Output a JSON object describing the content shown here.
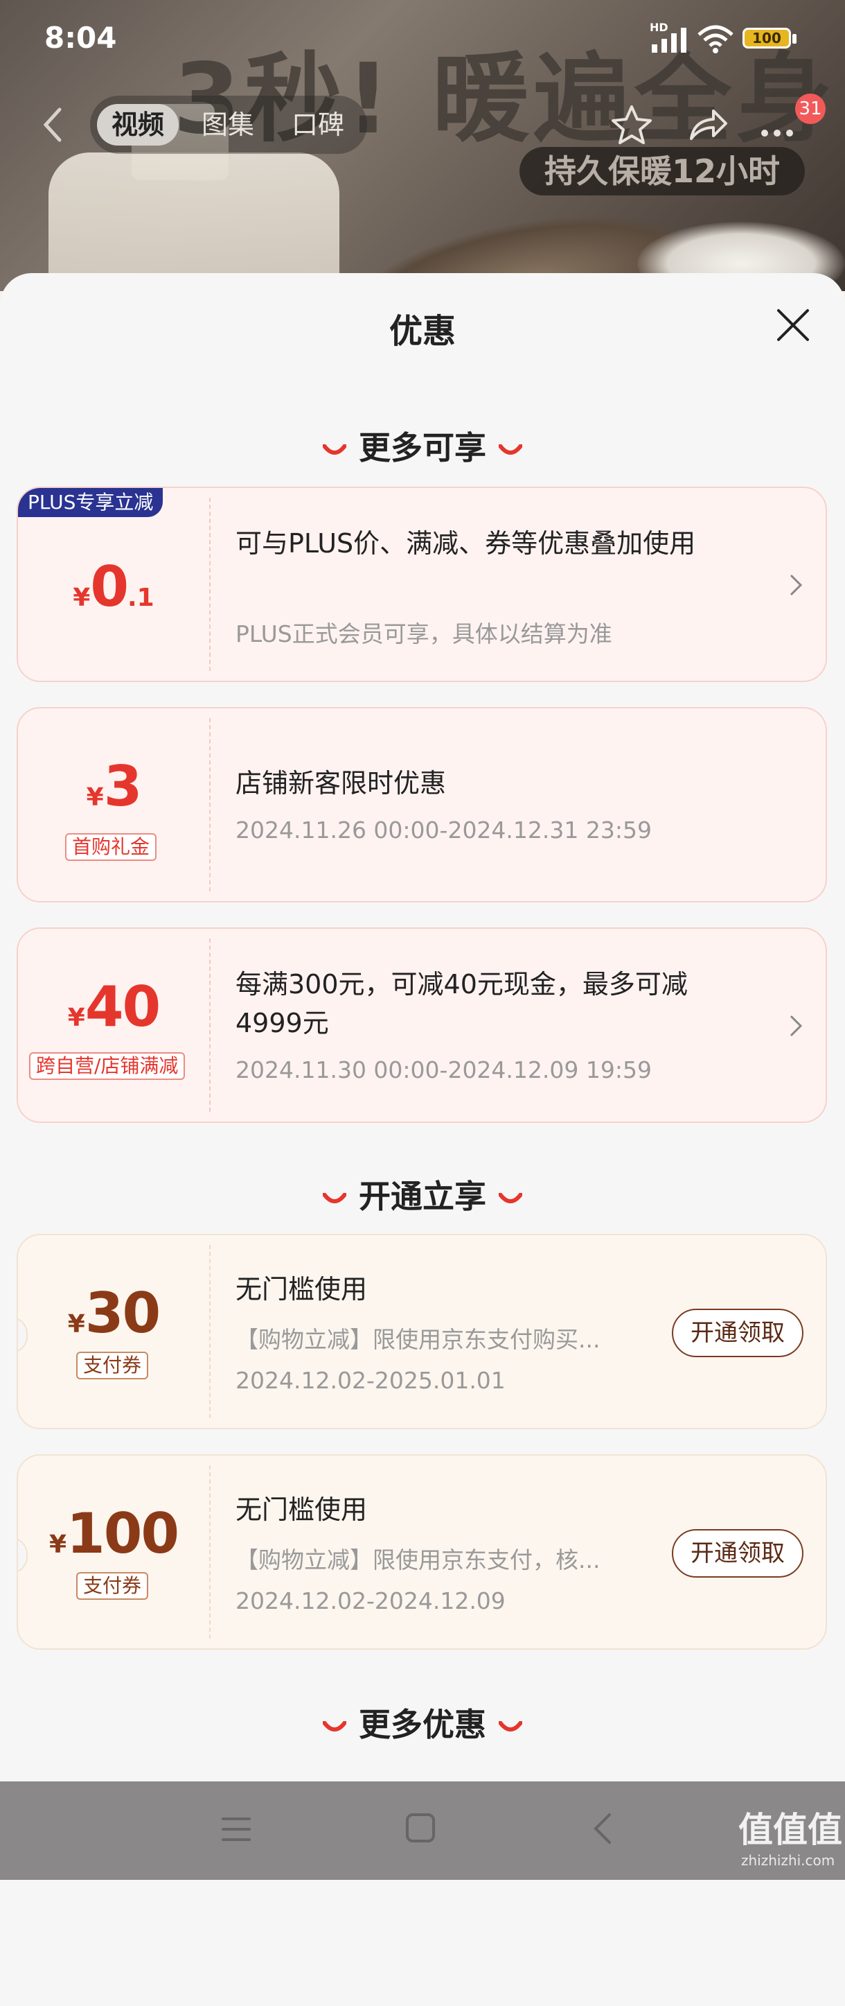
{
  "status_bar": {
    "time": "8:04",
    "network": "HD",
    "battery": "100"
  },
  "hero": {
    "headline": "3秒! 暖遍全身",
    "subline": "持久保暖12小时"
  },
  "top_nav": {
    "tabs": [
      {
        "label": "视频"
      },
      {
        "label": "图集"
      },
      {
        "label": "口碑"
      }
    ],
    "notification_count": "31"
  },
  "sheet": {
    "title": "优惠",
    "sections": [
      {
        "heading": "更多可享",
        "cards": [
          {
            "badge": "PLUS专享立减",
            "yen": "¥",
            "amount": "0",
            "decimal": ".1",
            "title": "可与PLUS价、满减、券等优惠叠加使用",
            "desc": "PLUS正式会员可享，具体以结算为准"
          },
          {
            "yen": "¥",
            "amount": "3",
            "tag": "首购礼金",
            "title": "店铺新客限时优惠",
            "desc": "2024.11.26 00:00-2024.12.31 23:59"
          },
          {
            "yen": "¥",
            "amount": "40",
            "tag": "跨自营/店铺满减",
            "title": "每满300元，可减40元现金，最多可减4999元",
            "desc": "2024.11.30 00:00-2024.12.09 19:59"
          }
        ]
      },
      {
        "heading": "开通立享",
        "cards": [
          {
            "yen": "¥",
            "amount": "30",
            "tag": "支付券",
            "title": "无门槛使用",
            "desc": "【购物立减】限使用京东支付购买...",
            "date": "2024.12.02-2025.01.01",
            "button": "开通领取"
          },
          {
            "yen": "¥",
            "amount": "100",
            "tag": "支付券",
            "title": "无门槛使用",
            "desc": "【购物立减】限使用京东支付，核...",
            "date": "2024.12.02-2024.12.09",
            "button": "开通领取"
          }
        ]
      },
      {
        "heading": "更多优惠"
      }
    ]
  },
  "watermark": {
    "text": "值值值",
    "sub": "zhizhizhi.com"
  },
  "colors": {
    "accent_red": "#e5362d",
    "plus_blue": "#2a3391",
    "coupon_brown": "#8b3a17"
  }
}
